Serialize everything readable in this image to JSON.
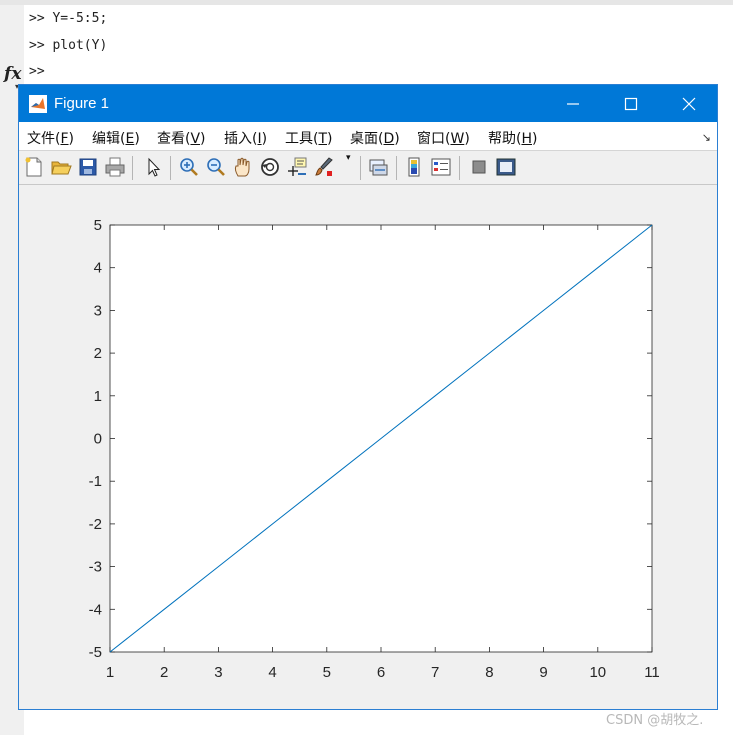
{
  "command_window": {
    "lines": [
      ">> Y=-5:5;",
      ">> plot(Y)"
    ],
    "prompt": ">>",
    "fx_label": "fx"
  },
  "figure_window": {
    "title": "Figure 1",
    "controls": [
      "minimize-icon",
      "maximize-icon",
      "close-icon"
    ],
    "title_bar_color": "#0078d7"
  },
  "menu": {
    "items": [
      {
        "label": "文件(",
        "key": "F",
        "suffix": ")"
      },
      {
        "label": "编辑(",
        "key": "E",
        "suffix": ")"
      },
      {
        "label": "查看(",
        "key": "V",
        "suffix": ")"
      },
      {
        "label": "插入(",
        "key": "I",
        "suffix": ")"
      },
      {
        "label": "工具(",
        "key": "T",
        "suffix": ")"
      },
      {
        "label": "桌面(",
        "key": "D",
        "suffix": ")"
      },
      {
        "label": "窗口(",
        "key": "W",
        "suffix": ")"
      },
      {
        "label": "帮助(",
        "key": "H",
        "suffix": ")"
      }
    ],
    "dock_glyph": "↘"
  },
  "toolbar": {
    "buttons": [
      "new-figure-icon",
      "open-file-icon",
      "save-icon",
      "print-icon",
      "edit-plot-arrow-icon",
      "zoom-in-icon",
      "zoom-out-icon",
      "pan-hand-icon",
      "rotate-3d-icon",
      "data-cursor-icon",
      "brush-icon",
      "link-plot-icon",
      "colorbar-icon",
      "legend-icon",
      "hide-plot-tools-icon",
      "show-plot-tools-icon"
    ]
  },
  "chart_data": {
    "type": "line",
    "x": [
      1,
      2,
      3,
      4,
      5,
      6,
      7,
      8,
      9,
      10,
      11
    ],
    "series": [
      {
        "values": [
          -5,
          -4,
          -3,
          -2,
          -1,
          0,
          1,
          2,
          3,
          4,
          5
        ],
        "color": "#0072bd"
      }
    ],
    "xlim": [
      1,
      11
    ],
    "ylim": [
      -5,
      5
    ],
    "xticks": [
      1,
      2,
      3,
      4,
      5,
      6,
      7,
      8,
      9,
      10,
      11
    ],
    "yticks": [
      -5,
      -4,
      -3,
      -2,
      -1,
      0,
      1,
      2,
      3,
      4,
      5
    ],
    "grid": false,
    "title": "",
    "xlabel": "",
    "ylabel": ""
  },
  "watermark": "CSDN @胡牧之."
}
